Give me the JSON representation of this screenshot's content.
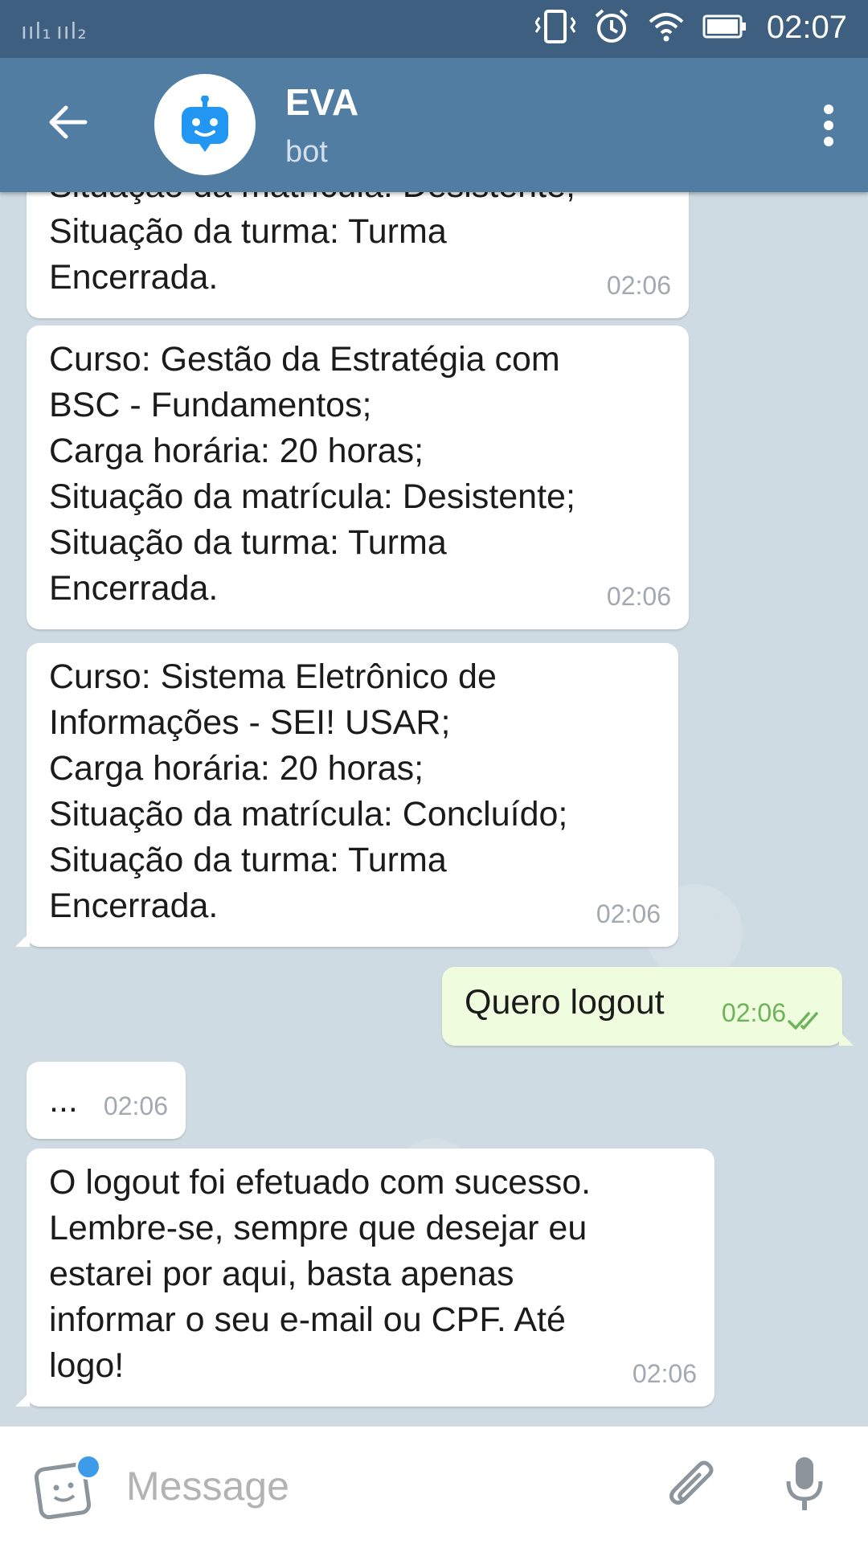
{
  "status_bar": {
    "time": "02:07",
    "signal_1": "ııl₁",
    "signal_2": "ııl₂"
  },
  "header": {
    "title": "EVA",
    "subtitle": "bot"
  },
  "messages": [
    {
      "text": "Situação da matrícula: Desistente;\nSituação da turma: Turma\nEncerrada.",
      "time": "02:06"
    },
    {
      "text": "Curso: Gestão da Estratégia com\nBSC - Fundamentos;\nCarga horária: 20 horas;\nSituação da matrícula: Desistente;\nSituação da turma: Turma\nEncerrada.",
      "time": "02:06"
    },
    {
      "text": "Curso: Sistema Eletrônico de\nInformações - SEI! USAR;\nCarga horária: 20 horas;\nSituação da matrícula: Concluído;\nSituação da turma: Turma\nEncerrada.",
      "time": "02:06"
    },
    {
      "text": "Quero logout",
      "time": "02:06"
    },
    {
      "text": "...",
      "time": "02:06"
    },
    {
      "text": "O logout foi efetuado com sucesso.\nLembre-se, sempre que desejar eu\nestarei por aqui, basta apenas\ninformar o seu e-mail ou CPF. Até\nlogo!",
      "time": "02:06"
    }
  ],
  "input": {
    "placeholder": "Message"
  },
  "colors": {
    "header": "#527da3",
    "status_bar": "#3e5f7f",
    "outgoing_bubble": "#effdde",
    "read_ticks": "#6cb359"
  }
}
